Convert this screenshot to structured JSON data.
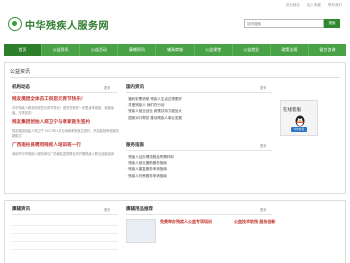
{
  "header": {
    "top_links": [
      "设为首页",
      "加入收藏",
      "联系我们"
    ],
    "site_title": "中华残疾人服务网",
    "search": {
      "placeholder": "站内搜索",
      "button": "搜索"
    }
  },
  "nav": {
    "items": [
      {
        "label": "首页",
        "active": true
      },
      {
        "label": "公益资讯",
        "active": false
      },
      {
        "label": "公益活动",
        "active": false
      },
      {
        "label": "康辅资讯",
        "active": false
      },
      {
        "label": "辅具商城",
        "active": false
      },
      {
        "label": "公益课堂",
        "active": false
      },
      {
        "label": "公益就业",
        "active": false
      },
      {
        "label": "政策法规",
        "active": false
      },
      {
        "label": "留言咨询",
        "active": false
      }
    ]
  },
  "news": {
    "title": "公益资讯",
    "org": {
      "heading": "机构动态",
      "more": "更多",
      "item1_title": "残友携团全体员工祝您元宵节快乐!",
      "item1_desc": "中华残疾人服务网祝您元宵节快乐！愿您在新的一年里身体健康、家庭幸福，万事如意！",
      "item2_title": "残友集团创始人郑卫宁与孝家医生签约",
      "item2_desc": "残友集团创始人郑卫宁 2017年1月与深圳孝家医生签约，开启智慧养老服务新模式",
      "item3_title": "广西南柱县聘用残疾人培训班一行",
      "item3_desc": "深圳市中华残疾人服务网与广西南柱县残联合作开展残疾人职业技能培训"
    },
    "domestic": {
      "heading": "国内资讯",
      "more": "更多",
      "items": [
        "福利彩票资助 残疾人生活过得更好",
        "关爱残疾人 我们在行动",
        "残疾人就业创业 政策扶持力度加大",
        "国家对口帮扶 推动残疾人事业发展"
      ]
    },
    "service": {
      "heading": "服务指南",
      "more": "更多",
      "items": [
        "残疾人证办理流程及所需材料",
        "残疾人就业援助服务指南",
        "残疾人康复服务申请指南",
        "残疾人托养服务申请指南"
      ]
    },
    "online": {
      "title": "在线客服",
      "badge": "QQ交谈"
    }
  },
  "bottom": {
    "rehab": {
      "heading": "康辅资讯",
      "more": "更多"
    },
    "goods": {
      "heading": "康辅用品推荐",
      "more": "更多"
    },
    "feature1": "免费举办残疾人公益专项培训",
    "feature2": "公益技术助残 服务创新"
  },
  "colors": {
    "brand_green": "#4aa247",
    "dark_green": "#2d7f2b",
    "headline_red": "#c0342e",
    "qq_blue": "#2a74c6"
  }
}
